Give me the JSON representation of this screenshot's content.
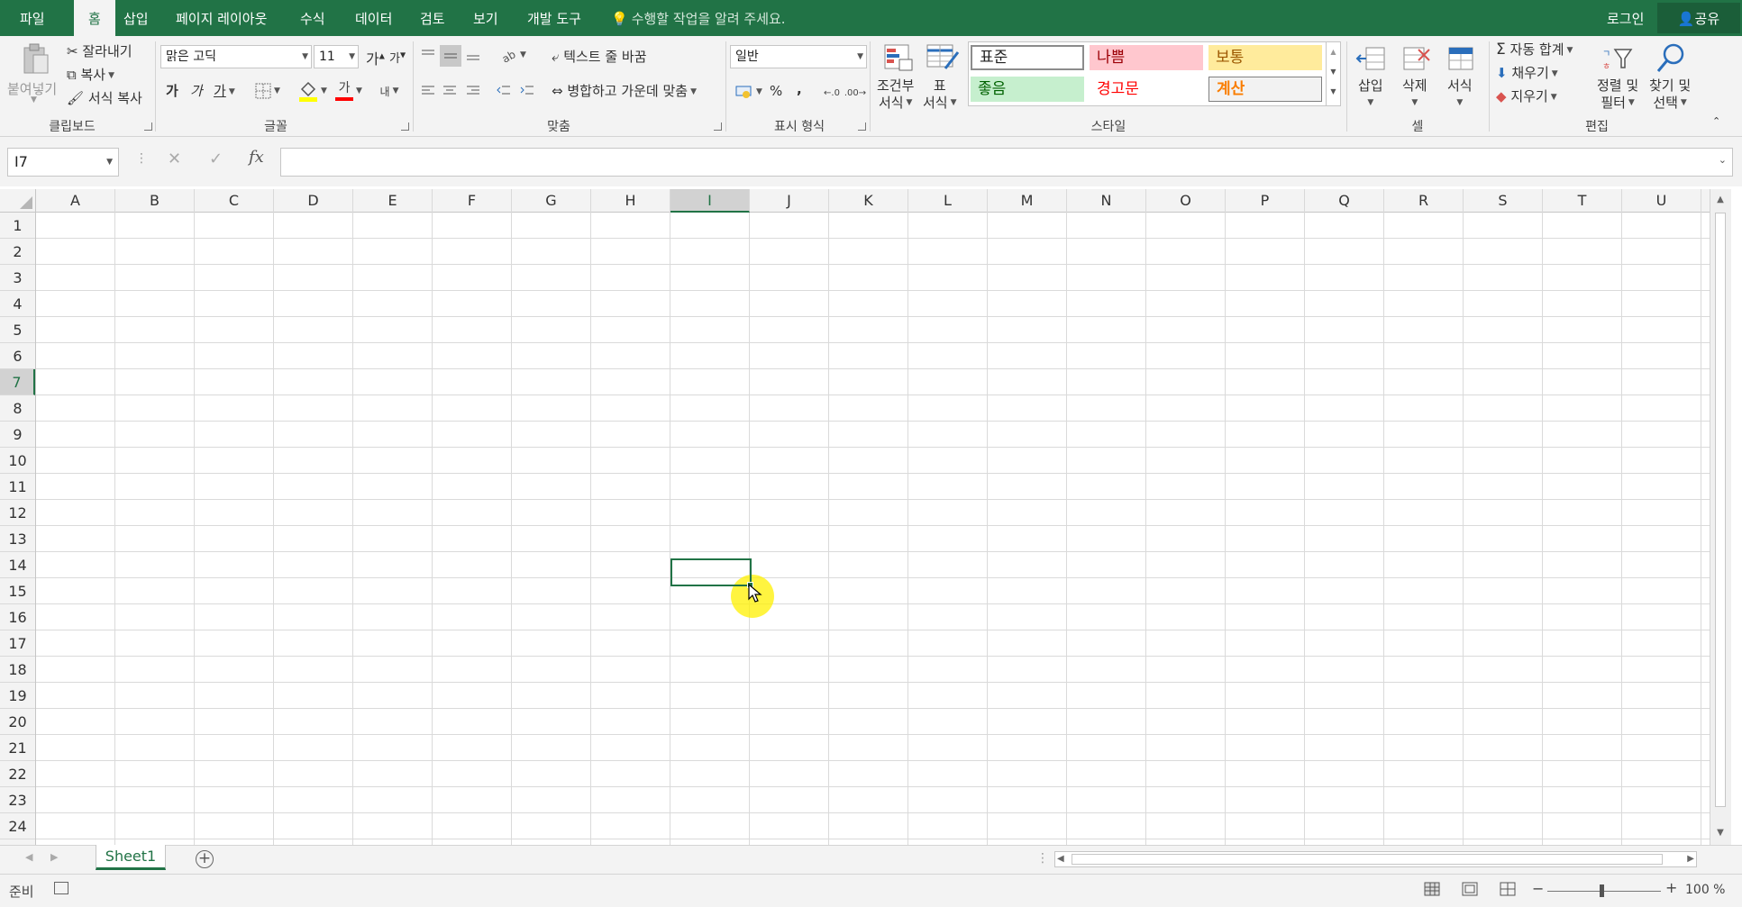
{
  "menu": {
    "tabs": [
      {
        "label": "파일"
      },
      {
        "label": "홈"
      },
      {
        "label": "삽입"
      },
      {
        "label": "페이지 레이아웃"
      },
      {
        "label": "수식"
      },
      {
        "label": "데이터"
      },
      {
        "label": "검토"
      },
      {
        "label": "보기"
      },
      {
        "label": "개발 도구"
      }
    ],
    "tell_me": "수행할 작업을 알려 주세요.",
    "login": "로그인",
    "share": "공유"
  },
  "ribbon": {
    "clipboard": {
      "paste": "붙여넣기",
      "cut": "잘라내기",
      "copy": "복사",
      "format_painter": "서식 복사",
      "label": "클립보드"
    },
    "font": {
      "name": "맑은 고딕",
      "size": "11",
      "bold": "가",
      "italic": "가",
      "underline": "가",
      "font_color_glyph": "가",
      "increase": "가",
      "decrease": "가",
      "label": "글꼴"
    },
    "alignment": {
      "wrap_text": "텍스트 줄 바꿈",
      "merge_center": "병합하고 가운데 맞춤",
      "label": "맞춤"
    },
    "number": {
      "format": "일반",
      "percent": "%",
      "comma": ",",
      "label": "표시 형식"
    },
    "styles": {
      "conditional": [
        "조건부",
        "서식"
      ],
      "format_table": [
        "표",
        "서식"
      ],
      "cells": [
        "표준",
        "나쁨",
        "보통",
        "좋음",
        "경고문",
        "계산"
      ],
      "label": "스타일"
    },
    "cells": {
      "insert": "삽입",
      "delete": "삭제",
      "format": "서식",
      "label": "셀"
    },
    "editing": {
      "autosum": "자동 합계",
      "fill": "채우기",
      "clear": "지우기",
      "sort_filter": [
        "정렬 및",
        "필터"
      ],
      "find_select": [
        "찾기 및",
        "선택"
      ],
      "label": "편집"
    }
  },
  "formula_bar": {
    "name_box": "I7",
    "fx": "fx",
    "value": ""
  },
  "grid": {
    "columns": [
      "A",
      "B",
      "C",
      "D",
      "E",
      "F",
      "G",
      "H",
      "I",
      "J",
      "K",
      "L",
      "M",
      "N",
      "O",
      "P",
      "Q",
      "R",
      "S",
      "T",
      "U"
    ],
    "rows": [
      "1",
      "2",
      "3",
      "4",
      "5",
      "6",
      "7",
      "8",
      "9",
      "10",
      "11",
      "12",
      "13",
      "14",
      "15",
      "16",
      "17",
      "18",
      "19",
      "20",
      "21",
      "22",
      "23",
      "24"
    ],
    "selected_column": "I",
    "selected_row": "7"
  },
  "sheets": {
    "tabs": [
      {
        "label": "Sheet1"
      }
    ],
    "add": "+"
  },
  "status": {
    "ready": "준비",
    "zoom": "100 %"
  },
  "colors": {
    "accent": "#217346",
    "bad_bg": "#ffc7ce",
    "bad_fg": "#9c0006",
    "neutral_bg": "#ffeb9c",
    "neutral_fg": "#9c5700",
    "good_bg": "#c6efce",
    "good_fg": "#006100",
    "warning_fg": "#ff0000",
    "calc_bg": "#f2f2f2",
    "calc_fg": "#fa7d00"
  }
}
